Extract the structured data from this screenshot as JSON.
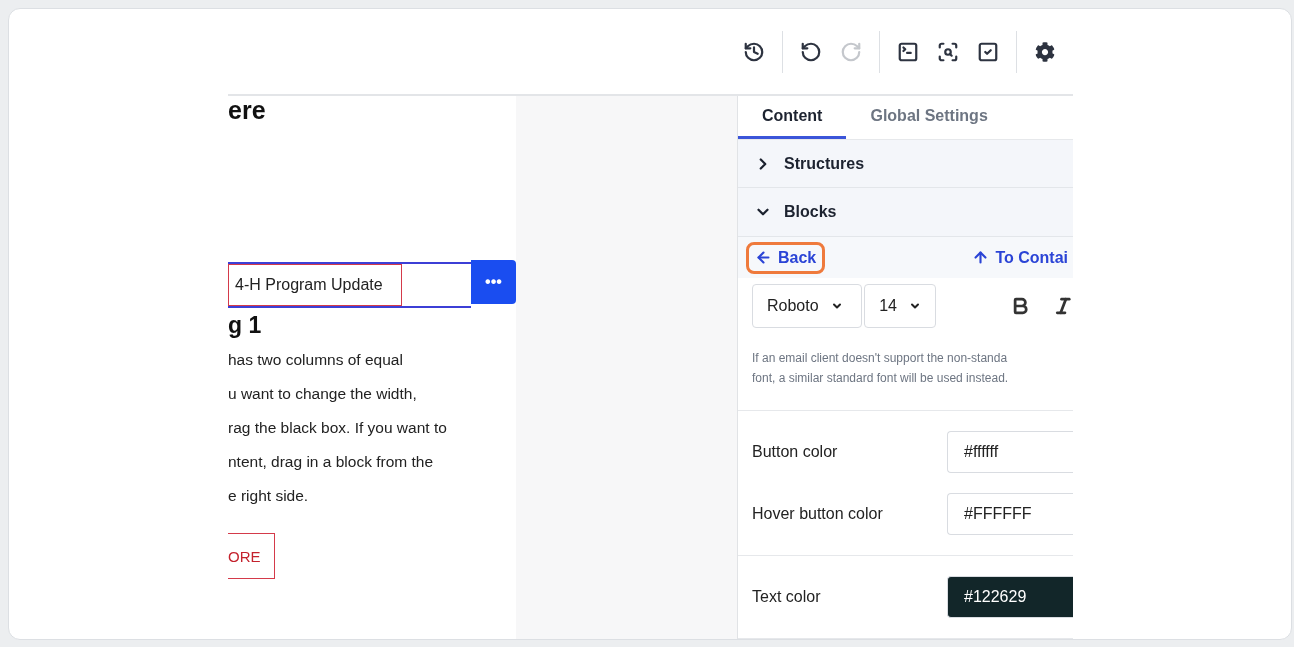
{
  "toolbar": {
    "buttons": [
      {
        "disabled": false
      },
      {
        "disabled": false
      },
      {
        "disabled": true
      },
      {
        "disabled": false
      },
      {
        "disabled": false
      },
      {
        "disabled": false
      },
      {
        "disabled": false
      }
    ]
  },
  "canvas": {
    "heading": "ere",
    "selected_block": {
      "text": "4-H Program Update",
      "menu": "•••"
    },
    "subheading": "g 1",
    "paragraph": [
      "has two columns of equal",
      "u want to change the width,",
      "rag the black box. If you want to",
      "ntent, drag in a block from the",
      "e right side."
    ],
    "button": "ORE"
  },
  "panel": {
    "tabs": [
      {
        "label": "Content",
        "selected": true
      },
      {
        "label": "Global Settings",
        "selected": false
      }
    ],
    "sections": [
      {
        "label": "Structures",
        "expanded": false
      },
      {
        "label": "Blocks",
        "expanded": true
      }
    ],
    "nav": {
      "back": "Back",
      "up": "To Contai"
    },
    "font": {
      "family": "Roboto",
      "size": "14"
    },
    "hint": [
      "If an email client doesn't support the non-standa",
      "font, a similar standard font will be used instead."
    ],
    "groups": [
      [
        {
          "label": "Button color",
          "value": "#ffffff",
          "dark": false
        },
        {
          "label": "Hover button color",
          "value": "#FFFFFF",
          "dark": false
        }
      ],
      [
        {
          "label": "Text color",
          "value": "#122629",
          "dark": true
        }
      ]
    ]
  }
}
